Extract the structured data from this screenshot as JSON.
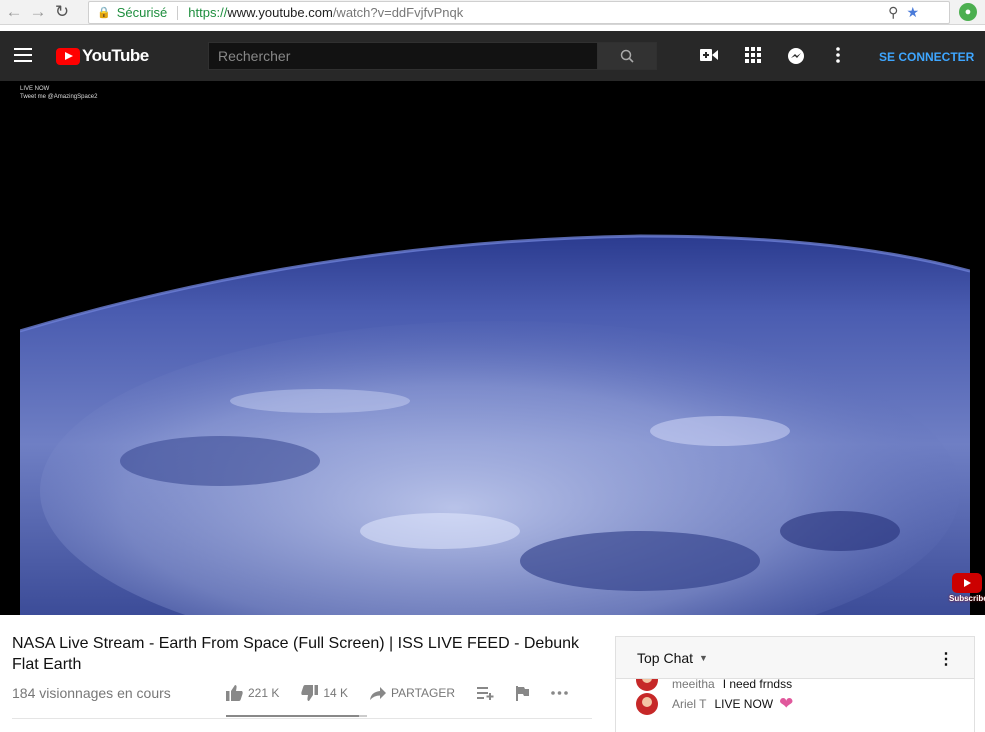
{
  "browser": {
    "secure_label": "Sécurisé",
    "url_scheme": "https://",
    "url_host": "www.youtube.com",
    "url_path": "/watch?v=ddFvjfvPnqk"
  },
  "header": {
    "logo_text": "YouTube",
    "search_placeholder": "Rechercher",
    "signin_label": "SE CONNECTER"
  },
  "player": {
    "overlay_line1": "LIVE NOW",
    "overlay_line2": "Tweet me @AmazingSpace2",
    "subscribe_label": "Subscribe"
  },
  "video": {
    "title": "NASA Live Stream - Earth From Space (Full Screen) | ISS LIVE FEED - Debunk Flat Earth",
    "views": "184 visionnages en cours",
    "likes": "221 K",
    "dislikes": "14 K",
    "share_label": "PARTAGER",
    "like_ratio": 0.94
  },
  "chat": {
    "title": "Top Chat",
    "messages": [
      {
        "author": "meeitha",
        "text": "I need frndss"
      },
      {
        "author": "Ariel T",
        "text": "LIVE NOW"
      }
    ]
  },
  "colors": {
    "header_bg": "#282828",
    "brand_red": "#ff0000",
    "signin_blue": "#3ea6ff"
  }
}
